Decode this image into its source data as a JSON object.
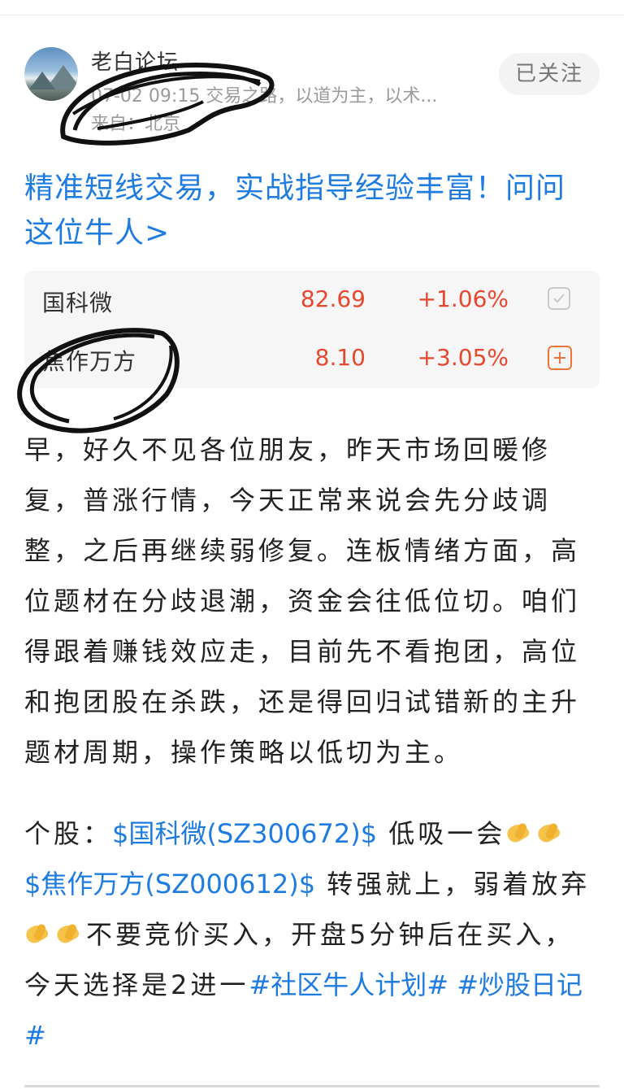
{
  "post": {
    "username": "老白论坛",
    "time": "07-02 09:15",
    "intro": "交易之路，以道为主，以术...",
    "location": "来自：北京",
    "follow_label": "已关注"
  },
  "promo": {
    "text": "精准短线交易，实战指导经验丰富！问问这位牛人>"
  },
  "stocks": [
    {
      "name": "国科微",
      "price": "82.69",
      "change": "+1.06%",
      "action_icon": "checkbox-icon"
    },
    {
      "name": "焦作万方",
      "price": "8.10",
      "change": "+3.05%",
      "action_icon": "plus-icon"
    }
  ],
  "content": {
    "paragraph1": "早，好久不见各位朋友，昨天市场回暖修复，普涨行情，今天正常来说会先分歧调整，之后再继续弱修复。连板情绪方面，高位题材在分歧退潮，资金会往低位切。咱们得跟着赚钱效应走，目前先不看抱团，高位和抱团股在杀跌，还是得回归试错新的主升题材周期，操作策略以低切为主。",
    "p2_prefix": "个股：",
    "stock_tag_1": "$国科微(SZ300672)$",
    "p2_text1": " 低吸一会",
    "stock_tag_2": "$焦作万方(SZ000612)$",
    "p2_text2": " 转强就上，弱着放弃",
    "p2_text3": "不要竞价买入，开盘5分钟后在买入，今天选择是2进一",
    "topic_1": "#社区牛人计划#",
    "topic_2": " #炒股日记#"
  },
  "colors": {
    "link": "#1e7be0",
    "up": "#e5482f",
    "plus": "#f0733a"
  }
}
